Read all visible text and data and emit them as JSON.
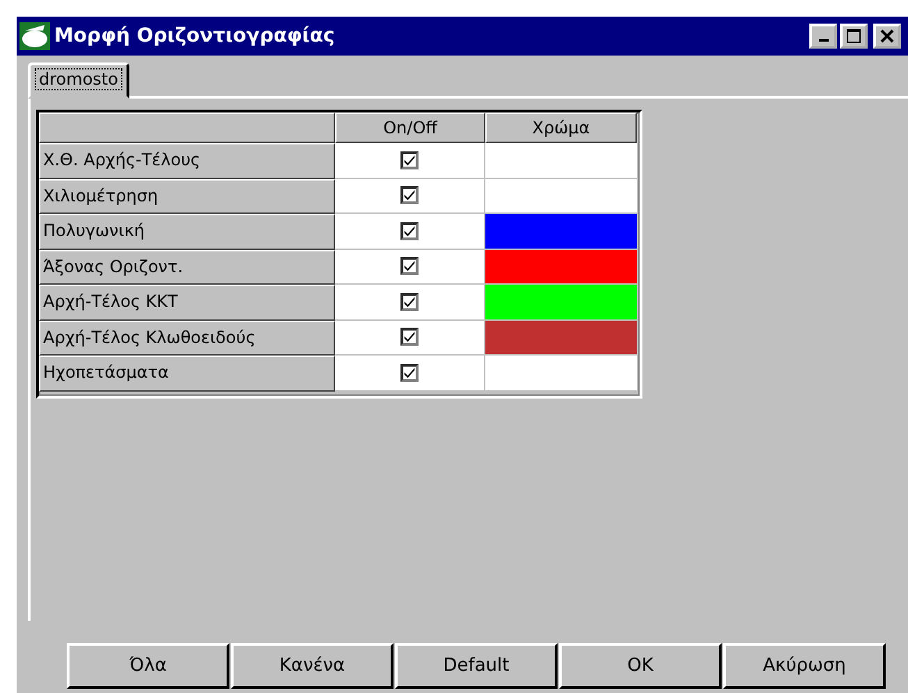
{
  "window": {
    "title": "Μορφή Οριζοντιογραφίας"
  },
  "tabs": [
    {
      "label": "dromosto",
      "selected": true
    }
  ],
  "table": {
    "columns": [
      "On/Off",
      "Χρώμα"
    ],
    "rows": [
      {
        "label": "Χ.Θ. Αρχής-Τέλους",
        "checked": true,
        "color": "#ffffff"
      },
      {
        "label": "Χιλιομέτρηση",
        "checked": true,
        "color": "#ffffff"
      },
      {
        "label": "Πολυγωνική",
        "checked": true,
        "color": "#0000ff"
      },
      {
        "label": "Άξονας Οριζοντ.",
        "checked": true,
        "color": "#ff0000"
      },
      {
        "label": "Αρχή-Τέλος ΚΚΤ",
        "checked": true,
        "color": "#00ff00"
      },
      {
        "label": "Αρχή-Τέλος Κλωθοειδούς",
        "checked": true,
        "color": "#c03030"
      },
      {
        "label": "Ηχοπετάσματα",
        "checked": true,
        "color": "#ffffff"
      }
    ]
  },
  "buttons": [
    "Όλα",
    "Κανένα",
    "Default",
    "OK",
    "Ακύρωση"
  ]
}
